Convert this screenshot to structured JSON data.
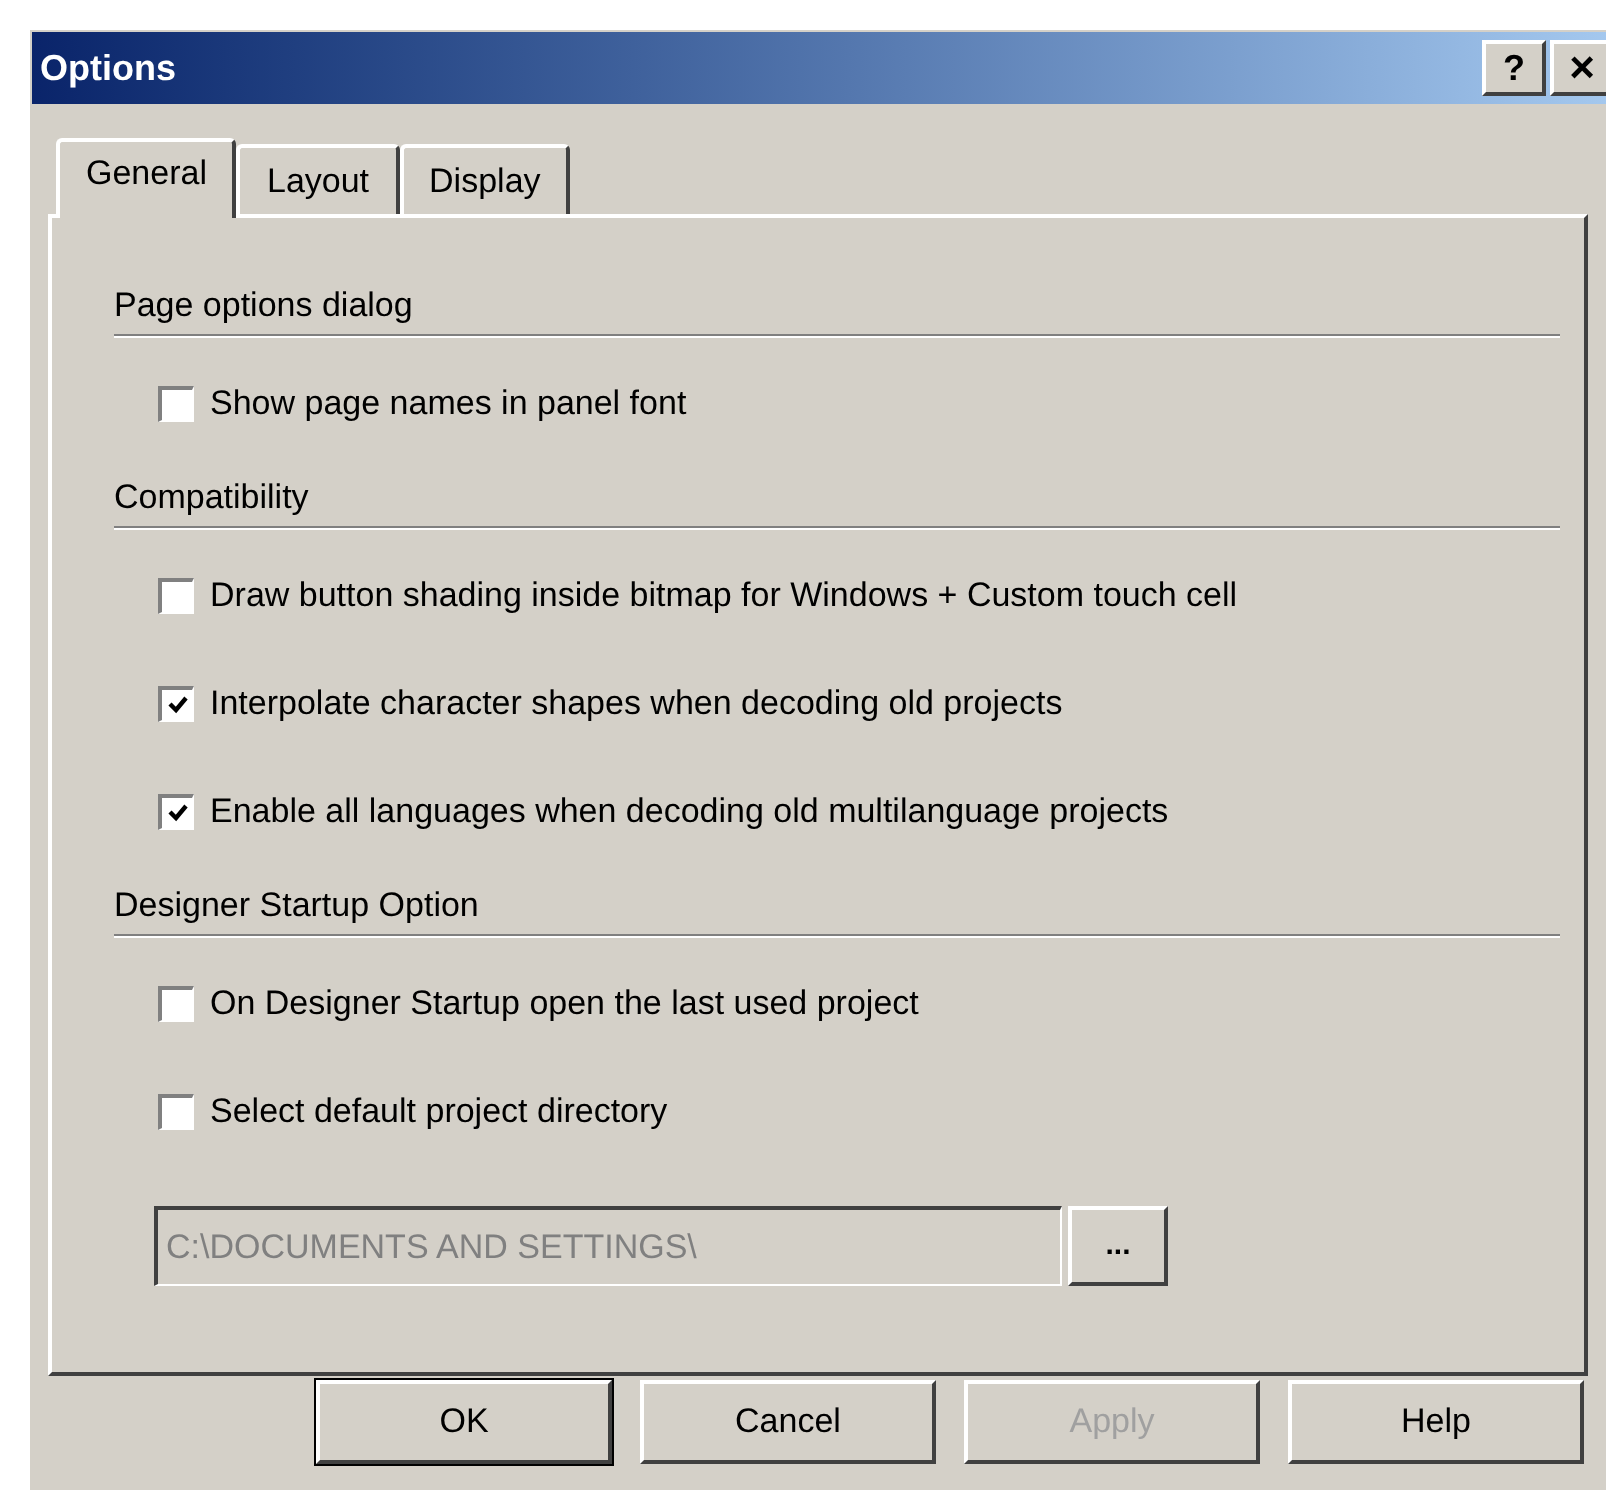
{
  "window": {
    "title": "Options",
    "help_button": "?",
    "close_button": "×"
  },
  "tabs": [
    {
      "label": "General",
      "selected": true
    },
    {
      "label": "Layout",
      "selected": false
    },
    {
      "label": "Display",
      "selected": false
    }
  ],
  "sections": [
    {
      "heading": "Page options dialog",
      "options": [
        {
          "label": "Show page names in panel font",
          "checked": false
        }
      ]
    },
    {
      "heading": "Compatibility",
      "options": [
        {
          "label": "Draw button shading inside bitmap for Windows + Custom touch cell",
          "checked": false
        },
        {
          "label": "Interpolate character shapes when decoding old projects",
          "checked": true
        },
        {
          "label": "Enable all languages when decoding old multilanguage projects",
          "checked": true
        }
      ]
    },
    {
      "heading": "Designer Startup Option",
      "options": [
        {
          "label": "On Designer Startup open the last used project",
          "checked": false
        },
        {
          "label": "Select default project directory",
          "checked": false
        }
      ]
    }
  ],
  "directory": {
    "value": "C:\\DOCUMENTS AND SETTINGS\\",
    "disabled": true,
    "browse_button": "..."
  },
  "buttons": [
    {
      "label": "OK",
      "default": true,
      "disabled": false
    },
    {
      "label": "Cancel",
      "default": false,
      "disabled": false
    },
    {
      "label": "Apply",
      "default": false,
      "disabled": true
    },
    {
      "label": "Help",
      "default": false,
      "disabled": false
    }
  ]
}
